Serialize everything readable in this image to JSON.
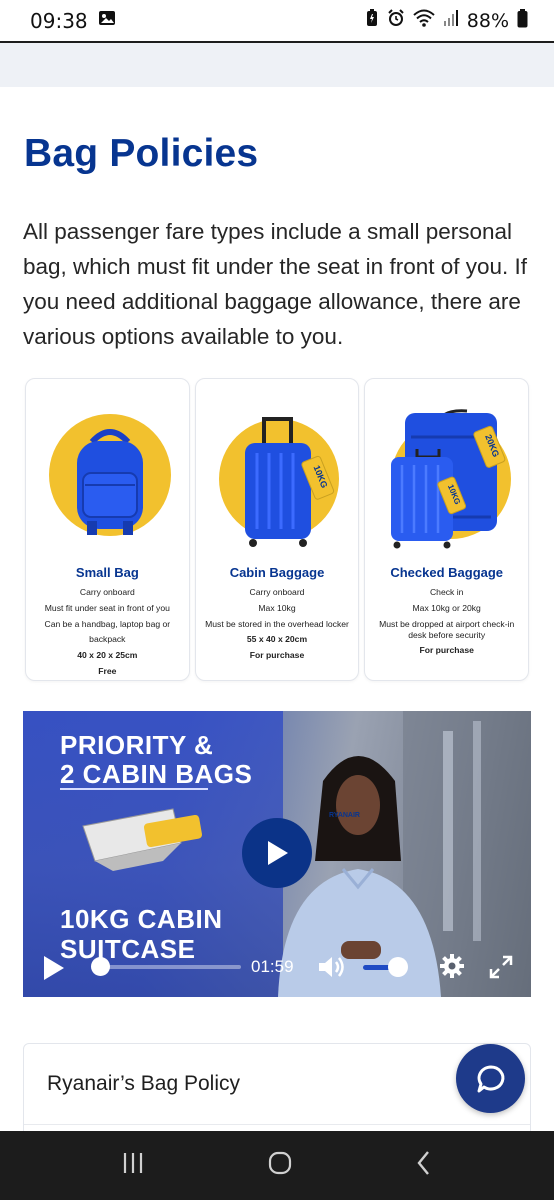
{
  "status": {
    "time": "09:38",
    "battery": "88%"
  },
  "page": {
    "title": "Bag Policies",
    "intro": "All passenger fare types include a small personal bag, which must fit under the seat in front of you. If you need additional baggage allowance, there are various options available to you."
  },
  "cards": [
    {
      "title": "Small Bag",
      "lines": [
        "Carry onboard",
        "Must fit under seat in front of you",
        "Can be a handbag, laptop bag or backpack",
        "40 x 20 x 25cm",
        "Free"
      ]
    },
    {
      "title": "Cabin Baggage",
      "lines": [
        "Carry onboard",
        "Max 10kg",
        "Must be stored in the overhead locker",
        "55 x 40 x 20cm",
        "For purchase"
      ],
      "tag": "10KG"
    },
    {
      "title": "Checked Baggage",
      "lines": [
        "Check in",
        "Max 10kg or 20kg",
        "Must be dropped at airport check-in desk before security",
        "For purchase"
      ],
      "tags": [
        "20KG",
        "10KG"
      ]
    }
  ],
  "video": {
    "headline_top_1": "PRIORITY &",
    "headline_top_2": "2 CABIN BAGS",
    "headline_bottom_1": "10KG CABIN",
    "headline_bottom_2": "SUITCASE",
    "shirt_logo": "RYANAIR",
    "time": "01:59",
    "progress": 0.05,
    "volume": 0.8
  },
  "accordion": {
    "title": "Ryanair’s Bag Policy"
  },
  "colors": {
    "brand_blue": "#073590",
    "accent_yellow": "#f2c12e",
    "bag_blue": "#1f4fe0"
  },
  "icons": [
    "image-icon",
    "battery-saver-icon",
    "alarm-icon",
    "wifi-icon",
    "signal-icon",
    "battery-icon",
    "play-icon",
    "volume-icon",
    "gear-icon",
    "fullscreen-icon",
    "chat-icon",
    "recent-apps-icon",
    "home-icon",
    "back-icon"
  ]
}
